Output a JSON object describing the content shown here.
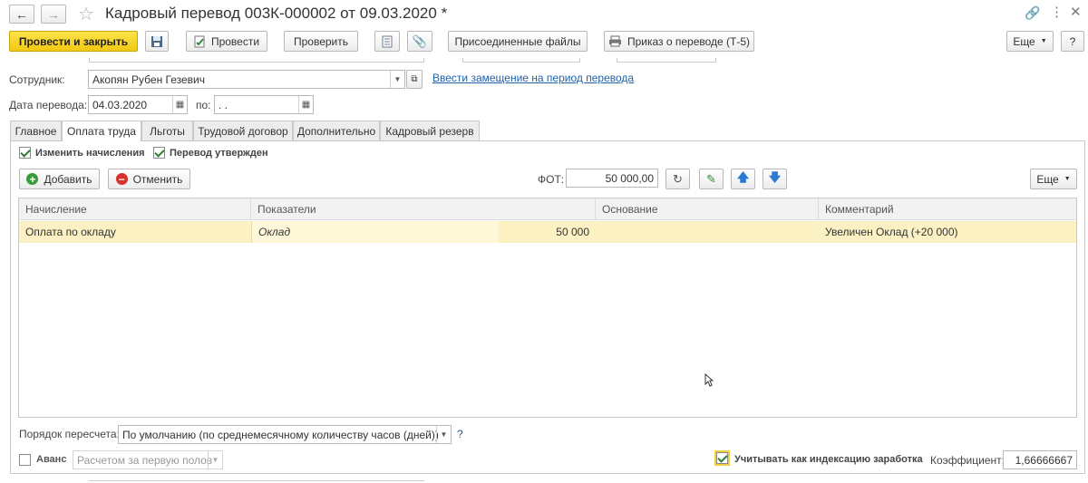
{
  "window": {
    "title": "Кадровый перевод 003К-000002 от 09.03.2020 *"
  },
  "toolbar": {
    "post_close": "Провести и закрыть",
    "post": "Провести",
    "check": "Проверить",
    "attached_files": "Присоединенные файлы",
    "print_order": "Приказ о переводе (Т-5)",
    "more": "Еще",
    "help": "?"
  },
  "form": {
    "employee_label": "Сотрудник:",
    "employee_value": "Акопян Рубен Гезевич",
    "replacement_link": "Ввести замещение на период перевода",
    "date_label": "Дата перевода:",
    "date_value": "04.03.2020",
    "to_label": "по:",
    "to_value": " .  .",
    "recalc_label": "Порядок пересчета:",
    "recalc_value": "По умолчанию (по среднемесячному количеству часов (дней))",
    "recalc_help": "?",
    "advance_label": "Аванс",
    "advance_value": "Расчетом за первую полов",
    "indexation_label": "Учитывать как индексацию заработка",
    "coef_label": "Коэффициент:",
    "coef_value": "1,66666667"
  },
  "tabs": [
    "Главное",
    "Оплата труда",
    "Льготы",
    "Трудовой договор",
    "Дополнительно",
    "Кадровый резерв"
  ],
  "pay": {
    "change_accruals": "Изменить начисления",
    "transfer_approved": "Перевод утвержден",
    "add": "Добавить",
    "cancel": "Отменить",
    "fot_label": "ФОТ:",
    "fot_value": "50 000,00",
    "more": "Еще"
  },
  "table": {
    "columns": [
      "Начисление",
      "Показатели",
      "Основание",
      "Комментарий"
    ],
    "rows": [
      {
        "accrual": "Оплата по окладу",
        "indicator": "Оклад",
        "value": "50 000",
        "basis": "",
        "comment": "Увеличен Оклад (+20 000)"
      }
    ]
  },
  "colors": {
    "primary": "#f5d21f",
    "selected_row": "#fbf1c2",
    "link": "#2062a8"
  }
}
